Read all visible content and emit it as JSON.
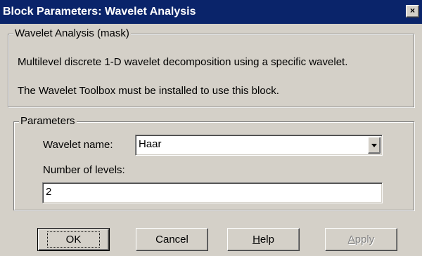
{
  "window": {
    "title": "Block Parameters: Wavelet Analysis",
    "close_glyph": "×"
  },
  "mask_group": {
    "legend": "Wavelet Analysis (mask)",
    "description_line1": "Multilevel discrete 1-D wavelet decomposition using a specific wavelet.",
    "description_line2": "The Wavelet Toolbox must be installed to use this block."
  },
  "parameters_group": {
    "legend": "Parameters",
    "wavelet_name_label": "Wavelet name:",
    "wavelet_name_value": "Haar",
    "levels_label": "Number of levels:",
    "levels_value": "2"
  },
  "buttons": {
    "ok": "OK",
    "cancel": "Cancel",
    "help": "Help",
    "apply": "Apply"
  }
}
